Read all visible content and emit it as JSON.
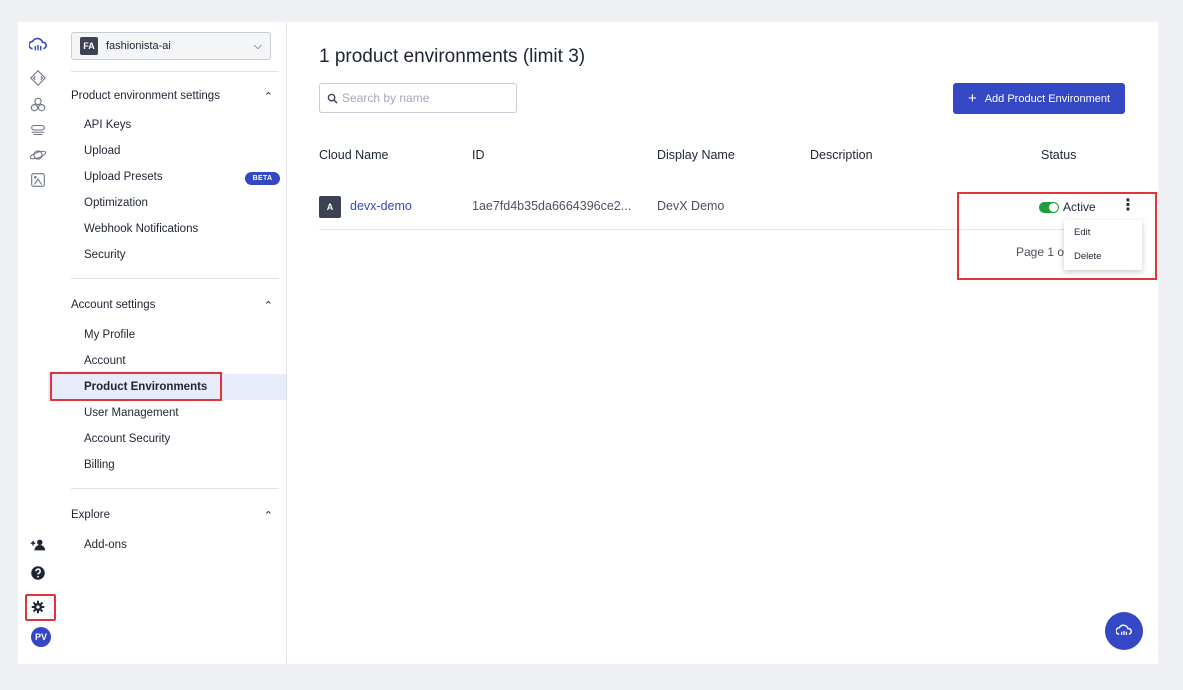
{
  "env_selector": {
    "badge": "FA",
    "name": "fashionista-ai"
  },
  "sections": {
    "product_env_settings": {
      "title": "Product environment settings",
      "items": [
        "API Keys",
        "Upload",
        "Upload Presets",
        "Optimization",
        "Webhook Notifications",
        "Security"
      ],
      "beta_badge": "BETA"
    },
    "account_settings": {
      "title": "Account settings",
      "items": [
        "My Profile",
        "Account",
        "Product Environments",
        "User Management",
        "Account Security",
        "Billing"
      ]
    },
    "explore": {
      "title": "Explore",
      "items": [
        "Add-ons"
      ]
    }
  },
  "rail": {
    "avatar": "PV"
  },
  "main": {
    "title": "1 product environments (limit 3)",
    "search_placeholder": "Search by name",
    "add_button": "Add Product Environment",
    "columns": [
      "Cloud Name",
      "ID",
      "Display Name",
      "Description",
      "Status"
    ],
    "rows": [
      {
        "avatar": "A",
        "cloud_name": "devx-demo",
        "id": "1ae7fd4b35da6664396ce2...",
        "display_name": "DevX Demo",
        "description": "",
        "status": "Active"
      }
    ],
    "pager": "Page 1 o",
    "row_menu": [
      "Edit",
      "Delete"
    ]
  },
  "colors": {
    "accent": "#3448c5",
    "active_green": "#1e9e3e",
    "highlight_red": "#e0333a"
  }
}
